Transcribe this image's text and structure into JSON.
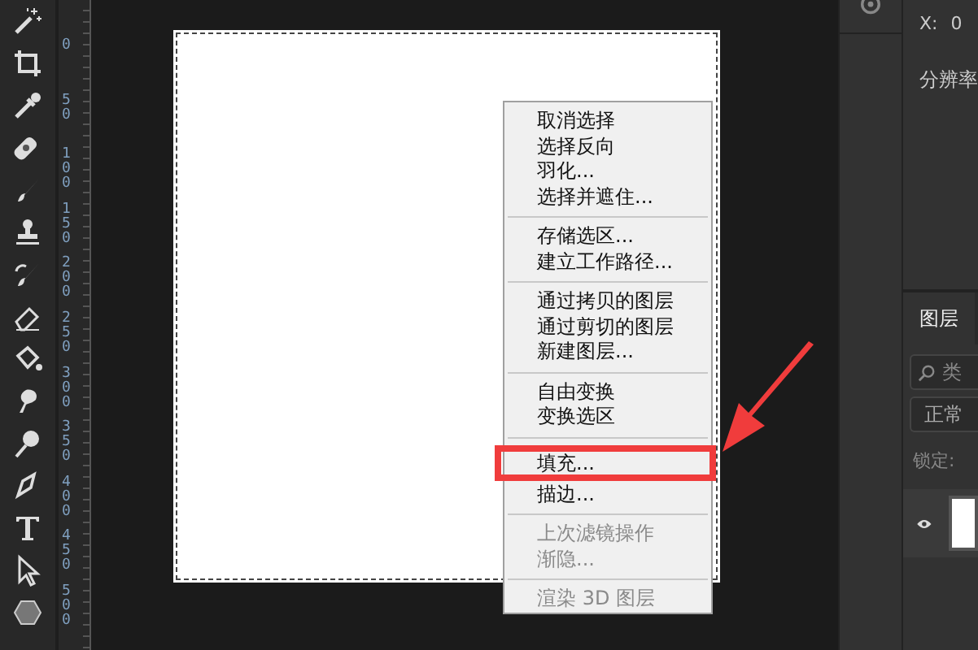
{
  "ruler": {
    "labels": [
      "0",
      "50",
      "100",
      "150",
      "200",
      "250",
      "300",
      "350",
      "400",
      "450",
      "500"
    ]
  },
  "context_menu": {
    "items": [
      {
        "kind": "item",
        "label": "取消选择",
        "disabled": false,
        "highlighted": false
      },
      {
        "kind": "item",
        "label": "选择反向",
        "disabled": false,
        "highlighted": false
      },
      {
        "kind": "item",
        "label": "羽化...",
        "disabled": false,
        "highlighted": false
      },
      {
        "kind": "item",
        "label": "选择并遮住...",
        "disabled": false,
        "highlighted": false
      },
      {
        "kind": "separator"
      },
      {
        "kind": "item",
        "label": "存储选区...",
        "disabled": false,
        "highlighted": false
      },
      {
        "kind": "item",
        "label": "建立工作路径...",
        "disabled": false,
        "highlighted": false
      },
      {
        "kind": "separator"
      },
      {
        "kind": "item",
        "label": "通过拷贝的图层",
        "disabled": false,
        "highlighted": false
      },
      {
        "kind": "item",
        "label": "通过剪切的图层",
        "disabled": false,
        "highlighted": false
      },
      {
        "kind": "item",
        "label": "新建图层...",
        "disabled": false,
        "highlighted": false
      },
      {
        "kind": "separator"
      },
      {
        "kind": "item",
        "label": "自由变换",
        "disabled": false,
        "highlighted": false
      },
      {
        "kind": "item",
        "label": "变换选区",
        "disabled": false,
        "highlighted": false
      },
      {
        "kind": "separator"
      },
      {
        "kind": "item",
        "label": "填充...",
        "disabled": false,
        "highlighted": true
      },
      {
        "kind": "item",
        "label": "描边...",
        "disabled": false,
        "highlighted": false
      },
      {
        "kind": "separator"
      },
      {
        "kind": "item",
        "label": "上次滤镜操作",
        "disabled": true,
        "highlighted": false
      },
      {
        "kind": "item",
        "label": "渐隐...",
        "disabled": true,
        "highlighted": false
      },
      {
        "kind": "separator"
      },
      {
        "kind": "item",
        "label": "渲染 3D 图层",
        "disabled": true,
        "highlighted": false
      }
    ]
  },
  "info_panel": {
    "x_label": "X:",
    "x_value": "0",
    "resolution_label": "分辨率"
  },
  "layers_panel": {
    "tabs": [
      {
        "label": "图层",
        "selected": true
      }
    ],
    "search": {
      "placeholder": "类"
    },
    "blend_mode": "正常",
    "lock_label": "锁定:",
    "layers": [
      {
        "visible": true
      }
    ]
  }
}
